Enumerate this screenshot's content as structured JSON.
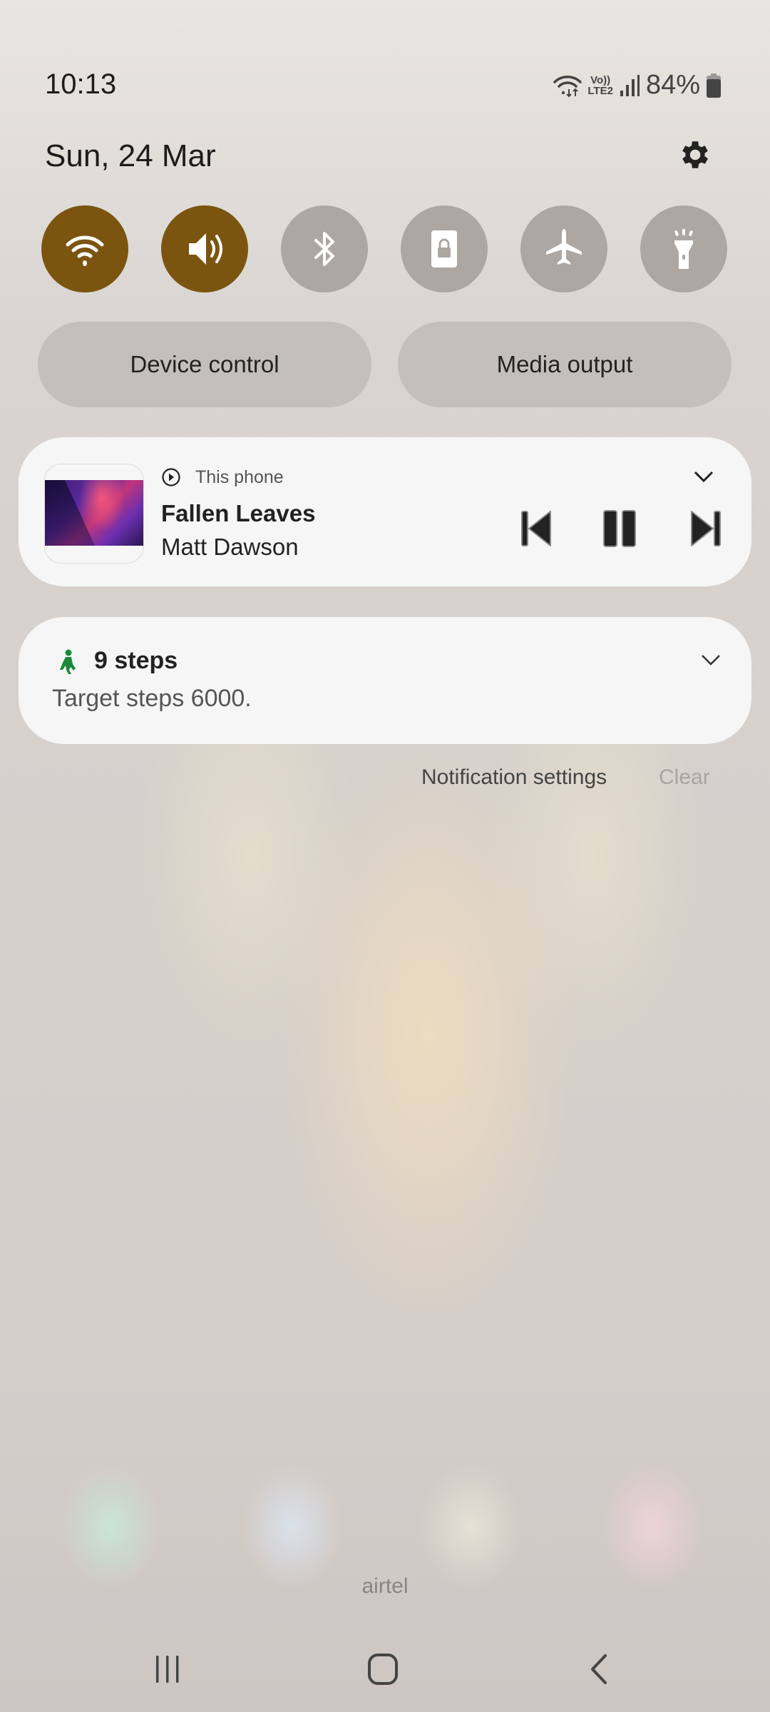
{
  "status_bar": {
    "time": "10:13",
    "volte_label": "Vo))",
    "lte_label": "LTE2",
    "battery_percent": "84%",
    "icons": [
      "wifi-data-icon",
      "volte-icon",
      "signal-icon",
      "battery-icon"
    ]
  },
  "header": {
    "date": "Sun, 24 Mar",
    "settings_icon": "gear-icon"
  },
  "quick_tiles": [
    {
      "name": "wifi",
      "icon": "wifi-icon",
      "state": "on"
    },
    {
      "name": "sound",
      "icon": "speaker-icon",
      "state": "on"
    },
    {
      "name": "bluetooth",
      "icon": "bluetooth-icon",
      "state": "off"
    },
    {
      "name": "rotation-lock",
      "icon": "lock-icon",
      "state": "off"
    },
    {
      "name": "airplane-mode",
      "icon": "airplane-icon",
      "state": "off"
    },
    {
      "name": "flashlight",
      "icon": "flashlight-icon",
      "state": "off"
    }
  ],
  "colors": {
    "tile_on": "#7b5510",
    "tile_off": "#aca7a3",
    "steps_green": "#1a8a3a"
  },
  "buttons": {
    "device_control": "Device control",
    "media_output": "Media output"
  },
  "media": {
    "source": "This phone",
    "title": "Fallen Leaves",
    "artist": "Matt Dawson",
    "controls": [
      "previous",
      "pause",
      "next"
    ]
  },
  "steps_notification": {
    "title": "9 steps",
    "body": "Target steps 6000."
  },
  "footer_actions": {
    "notification_settings": "Notification settings",
    "clear": "Clear"
  },
  "carrier": "airtel",
  "nav_bar": [
    "recents",
    "home",
    "back"
  ]
}
